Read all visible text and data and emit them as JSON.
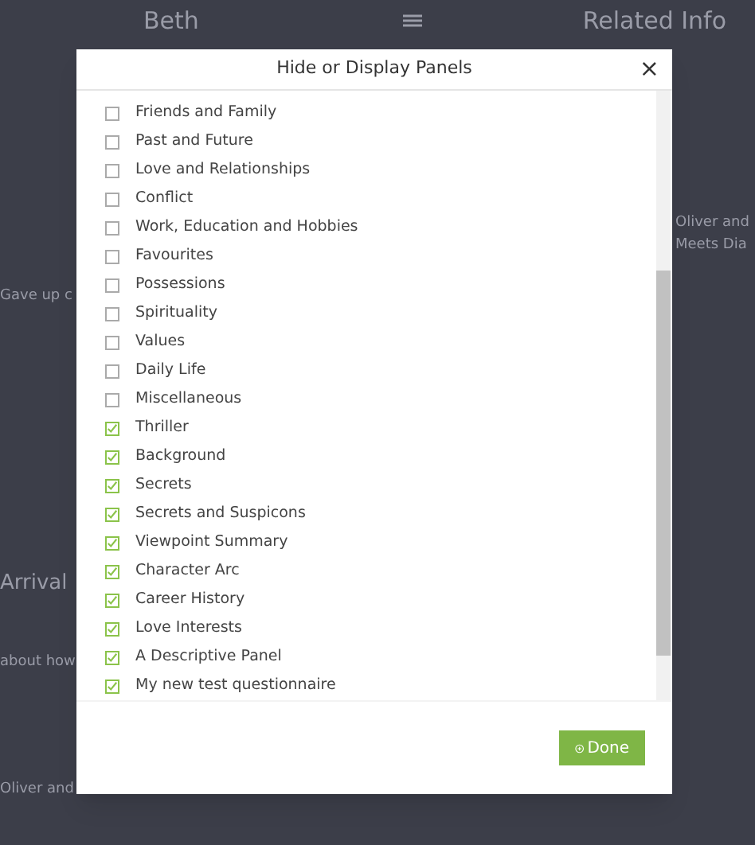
{
  "background": {
    "header": {
      "left_title": "Beth",
      "right_title": "Related Info"
    },
    "left_fragments": [
      "Gave up c",
      "Arrival",
      "about how",
      "Oliver and"
    ],
    "right_fragments": [
      "Oliver and",
      "Meets Dia"
    ]
  },
  "dialog": {
    "title": "Hide or Display Panels",
    "close": "×",
    "panels": [
      {
        "label": "Friends and Family",
        "checked": false
      },
      {
        "label": "Past and Future",
        "checked": false
      },
      {
        "label": "Love and Relationships",
        "checked": false
      },
      {
        "label": "Conflict",
        "checked": false
      },
      {
        "label": "Work, Education and Hobbies",
        "checked": false
      },
      {
        "label": "Favourites",
        "checked": false
      },
      {
        "label": "Possessions",
        "checked": false
      },
      {
        "label": "Spirituality",
        "checked": false
      },
      {
        "label": "Values",
        "checked": false
      },
      {
        "label": "Daily Life",
        "checked": false
      },
      {
        "label": "Miscellaneous",
        "checked": false
      },
      {
        "label": "Thriller",
        "checked": true
      },
      {
        "label": "Background",
        "checked": true
      },
      {
        "label": "Secrets",
        "checked": true
      },
      {
        "label": "Secrets and Suspicons",
        "checked": true
      },
      {
        "label": "Viewpoint Summary",
        "checked": true
      },
      {
        "label": "Character Arc",
        "checked": true
      },
      {
        "label": "Career History",
        "checked": true
      },
      {
        "label": "Love Interests",
        "checked": true
      },
      {
        "label": "A Descriptive Panel",
        "checked": true
      },
      {
        "label": "My new test questionnaire",
        "checked": true
      }
    ],
    "done_button": "Done"
  }
}
